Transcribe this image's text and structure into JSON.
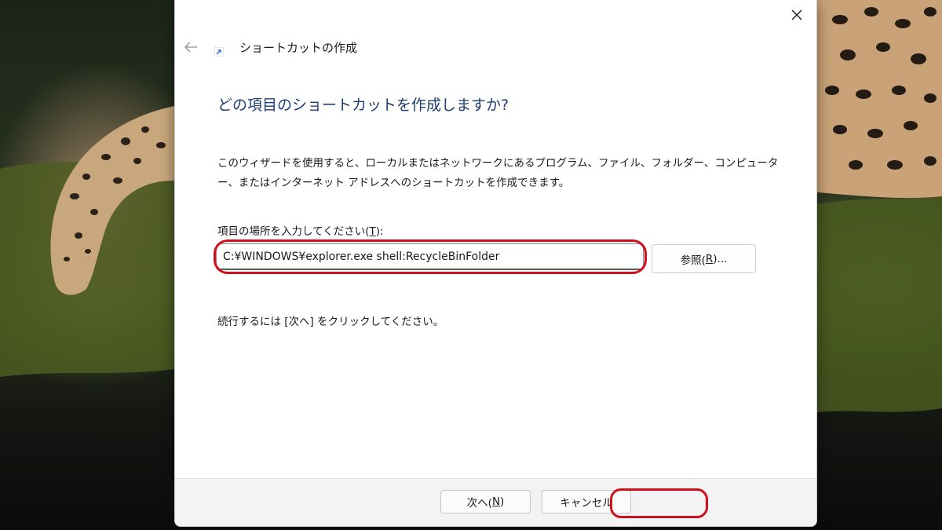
{
  "window": {
    "title": "ショートカットの作成",
    "close_icon": "close-icon",
    "back_icon": "back-arrow-icon",
    "shortcut_icon": "shortcut-arrow-icon"
  },
  "main": {
    "heading": "どの項目のショートカットを作成しますか?",
    "description": "このウィザードを使用すると、ローカルまたはネットワークにあるプログラム、ファイル、フォルダー、コンピューター、またはインターネット アドレスへのショートカットを作成できます。",
    "location_label_prefix": "項目の場所を入力してください(",
    "location_label_key": "T",
    "location_label_suffix": "):",
    "location_value": "C:¥WINDOWS¥explorer.exe shell:RecycleBinFolder",
    "browse_prefix": "参照(",
    "browse_key": "R",
    "browse_suffix": ")...",
    "continue_text": "続行するには [次へ] をクリックしてください。"
  },
  "footer": {
    "next_prefix": "次へ(",
    "next_key": "N",
    "next_suffix": ")",
    "cancel_label": "キャンセル"
  },
  "colors": {
    "heading": "#1e3e74",
    "highlight": "#d00f1c",
    "footer_bg": "#f3f3f3"
  }
}
